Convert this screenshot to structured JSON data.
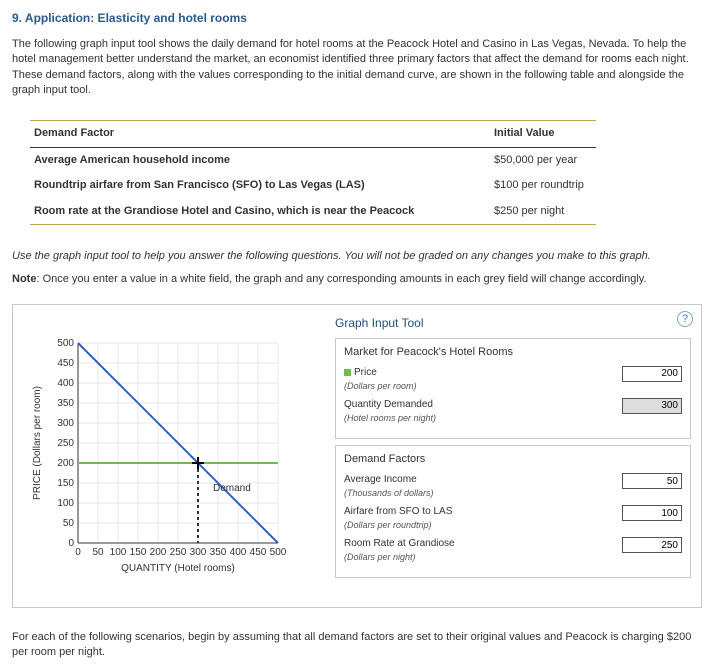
{
  "title": "9. Application: Elasticity and hotel rooms",
  "intro": "The following graph input tool shows the daily demand for hotel rooms at the Peacock Hotel and Casino in Las Vegas, Nevada. To help the hotel management better understand the market, an economist identified three primary factors that affect the demand for rooms each night. These demand factors, along with the values corresponding to the initial demand curve, are shown in the following table and alongside the graph input tool.",
  "table": {
    "header_factor": "Demand Factor",
    "header_value": "Initial Value",
    "rows": [
      {
        "factor": "Average American household income",
        "value": "$50,000 per year"
      },
      {
        "factor": "Roundtrip airfare from San Francisco (SFO) to Las Vegas (LAS)",
        "value": "$100 per roundtrip"
      },
      {
        "factor": "Room rate at the Grandiose Hotel and Casino, which is near the Peacock",
        "value": "$250 per night"
      }
    ]
  },
  "instr": "Use the graph input tool to help you answer the following questions. You will not be graded on any changes you make to this graph.",
  "note_bold": "Note",
  "note_rest": ": Once you enter a value in a white field, the graph and any corresponding amounts in each grey field will change accordingly.",
  "tool": {
    "title": "Graph Input Tool",
    "help": "?",
    "market_title": "Market for Peacock's Hotel Rooms",
    "price_label": "Price",
    "price_sub": "(Dollars per room)",
    "price_value": "200",
    "qty_label": "Quantity Demanded",
    "qty_sub": "(Hotel rooms per night)",
    "qty_value": "300",
    "factors_title": "Demand Factors",
    "income_label": "Average Income",
    "income_sub": "(Thousands of dollars)",
    "income_value": "50",
    "airfare_label": "Airfare from SFO to LAS",
    "airfare_sub": "(Dollars per roundtrip)",
    "airfare_value": "100",
    "grandiose_label": "Room Rate at Grandiose",
    "grandiose_sub": "(Dollars per night)",
    "grandiose_value": "250"
  },
  "chart_data": {
    "type": "line",
    "xlabel": "QUANTITY (Hotel rooms)",
    "ylabel": "PRICE (Dollars per room)",
    "xlim": [
      0,
      500
    ],
    "ylim": [
      0,
      500
    ],
    "xticks": [
      0,
      50,
      100,
      150,
      200,
      250,
      300,
      350,
      400,
      450,
      500
    ],
    "yticks": [
      0,
      50,
      100,
      150,
      200,
      250,
      300,
      350,
      400,
      450,
      500
    ],
    "series": [
      {
        "name": "Demand",
        "color": "#2a62c9",
        "x": [
          0,
          500
        ],
        "y": [
          500,
          0
        ]
      },
      {
        "name": "Price line",
        "color": "#6bbf4a",
        "x": [
          0,
          500
        ],
        "y": [
          200,
          200
        ]
      }
    ],
    "crosshair": {
      "x": 300,
      "y": 200
    }
  },
  "footer_q": "For each of the following scenarios, begin by assuming that all demand factors are set to their original values and Peacock is charging $200 per room per night."
}
